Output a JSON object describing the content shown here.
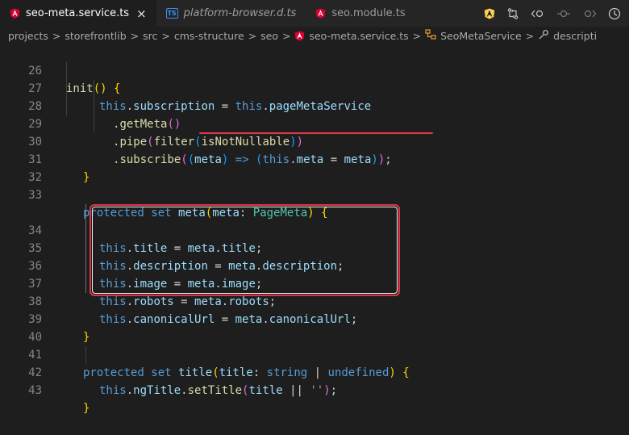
{
  "tabs": [
    {
      "label": "seo-meta.service.ts",
      "icon": "angular-icon",
      "active": true,
      "italic": false,
      "close": "×"
    },
    {
      "label": "platform-browser.d.ts",
      "icon": "typescript-icon",
      "icon_text": "TS",
      "active": false,
      "italic": true
    },
    {
      "label": "seo.module.ts",
      "icon": "angular-icon",
      "active": false,
      "italic": false
    }
  ],
  "tab_actions": [
    "angular-icon",
    "git-compare-icon",
    "go-back-icon",
    "commit-icon",
    "go-forward-icon",
    "timeline-icon"
  ],
  "breadcrumb": {
    "items": [
      "projects",
      "storefrontlib",
      "src",
      "cms-structure",
      "seo",
      "seo-meta.service.ts",
      "SeoMetaService",
      "descripti"
    ],
    "separator": ">"
  },
  "colors": {
    "editor_bg": "#1e1e1e",
    "keyword": "#569cd6",
    "function": "#dcdcaa",
    "property": "#9cdcfe",
    "type": "#4ec9b0",
    "string": "#ce9178",
    "angular": "#dd0031",
    "highlight": "#e0334a"
  },
  "code": {
    "line_numbers": [
      "26",
      "27",
      "28",
      "29",
      "30",
      "31",
      "32",
      "33",
      "34",
      "35",
      "36",
      "37",
      "38",
      "39",
      "40",
      "41",
      "42",
      "43"
    ],
    "line_26": {
      "p1": "init",
      "p2": "(",
      "p3": ")",
      "p4": " {"
    },
    "line_27": {
      "p1": "this",
      "p2": ".",
      "p3": "subscription",
      "p4": " = ",
      "p5": "this",
      "p6": ".",
      "p7": "pageMetaService"
    },
    "line_28": {
      "p1": ".",
      "p2": "getMeta",
      "p3": "()"
    },
    "line_29": {
      "p1": ".",
      "p2": "pipe",
      "p3": "(",
      "p4": "filter",
      "p5": "(",
      "p6": "isNotNullable",
      "p7": ")",
      "p8": ")"
    },
    "line_30": {
      "p1": ".",
      "p2": "subscribe",
      "p3": "(",
      "p4": "(",
      "p5": "meta",
      "p6": ")",
      "p7": " => ",
      "p8": "(",
      "p9": "this",
      "p10": ".",
      "p11": "meta",
      "p12": " = ",
      "p13": "meta",
      "p14": ")",
      "p15": ")",
      "p16": ";"
    },
    "line_31": {
      "p1": "}"
    },
    "line_33": {
      "p1": "protected",
      "p2": " ",
      "p3": "set",
      "p4": " ",
      "p5": "meta",
      "p6": "(",
      "p7": "meta",
      "p8": ": ",
      "p9": "PageMeta",
      "p10": ")",
      "p11": " {"
    },
    "line_34": {
      "p1": "this",
      "p2": ".",
      "p3": "title",
      "p4": " = ",
      "p5": "meta",
      "p6": ".",
      "p7": "title",
      "p8": ";"
    },
    "line_35": {
      "p1": "this",
      "p2": ".",
      "p3": "description",
      "p4": " = ",
      "p5": "meta",
      "p6": ".",
      "p7": "description",
      "p8": ";"
    },
    "line_36": {
      "p1": "this",
      "p2": ".",
      "p3": "image",
      "p4": " = ",
      "p5": "meta",
      "p6": ".",
      "p7": "image",
      "p8": ";"
    },
    "line_37": {
      "p1": "this",
      "p2": ".",
      "p3": "robots",
      "p4": " = ",
      "p5": "meta",
      "p6": ".",
      "p7": "robots",
      "p8": ";"
    },
    "line_38": {
      "p1": "this",
      "p2": ".",
      "p3": "canonicalUrl",
      "p4": " = ",
      "p5": "meta",
      "p6": ".",
      "p7": "canonicalUrl",
      "p8": ";"
    },
    "line_39": {
      "p1": "}"
    },
    "line_41": {
      "p1": "protected",
      "p2": " ",
      "p3": "set",
      "p4": " ",
      "p5": "title",
      "p6": "(",
      "p7": "title",
      "p8": ": ",
      "p9": "string",
      "p10": " | ",
      "p11": "undefined",
      "p12": ")",
      "p13": " {"
    },
    "line_42": {
      "p1": "this",
      "p2": ".",
      "p3": "ngTitle",
      "p4": ".",
      "p5": "setTitle",
      "p6": "(",
      "p7": "title",
      "p8": " || ",
      "p9": "''",
      "p10": ")",
      "p11": ";"
    },
    "line_43": {
      "p1": "}"
    }
  }
}
